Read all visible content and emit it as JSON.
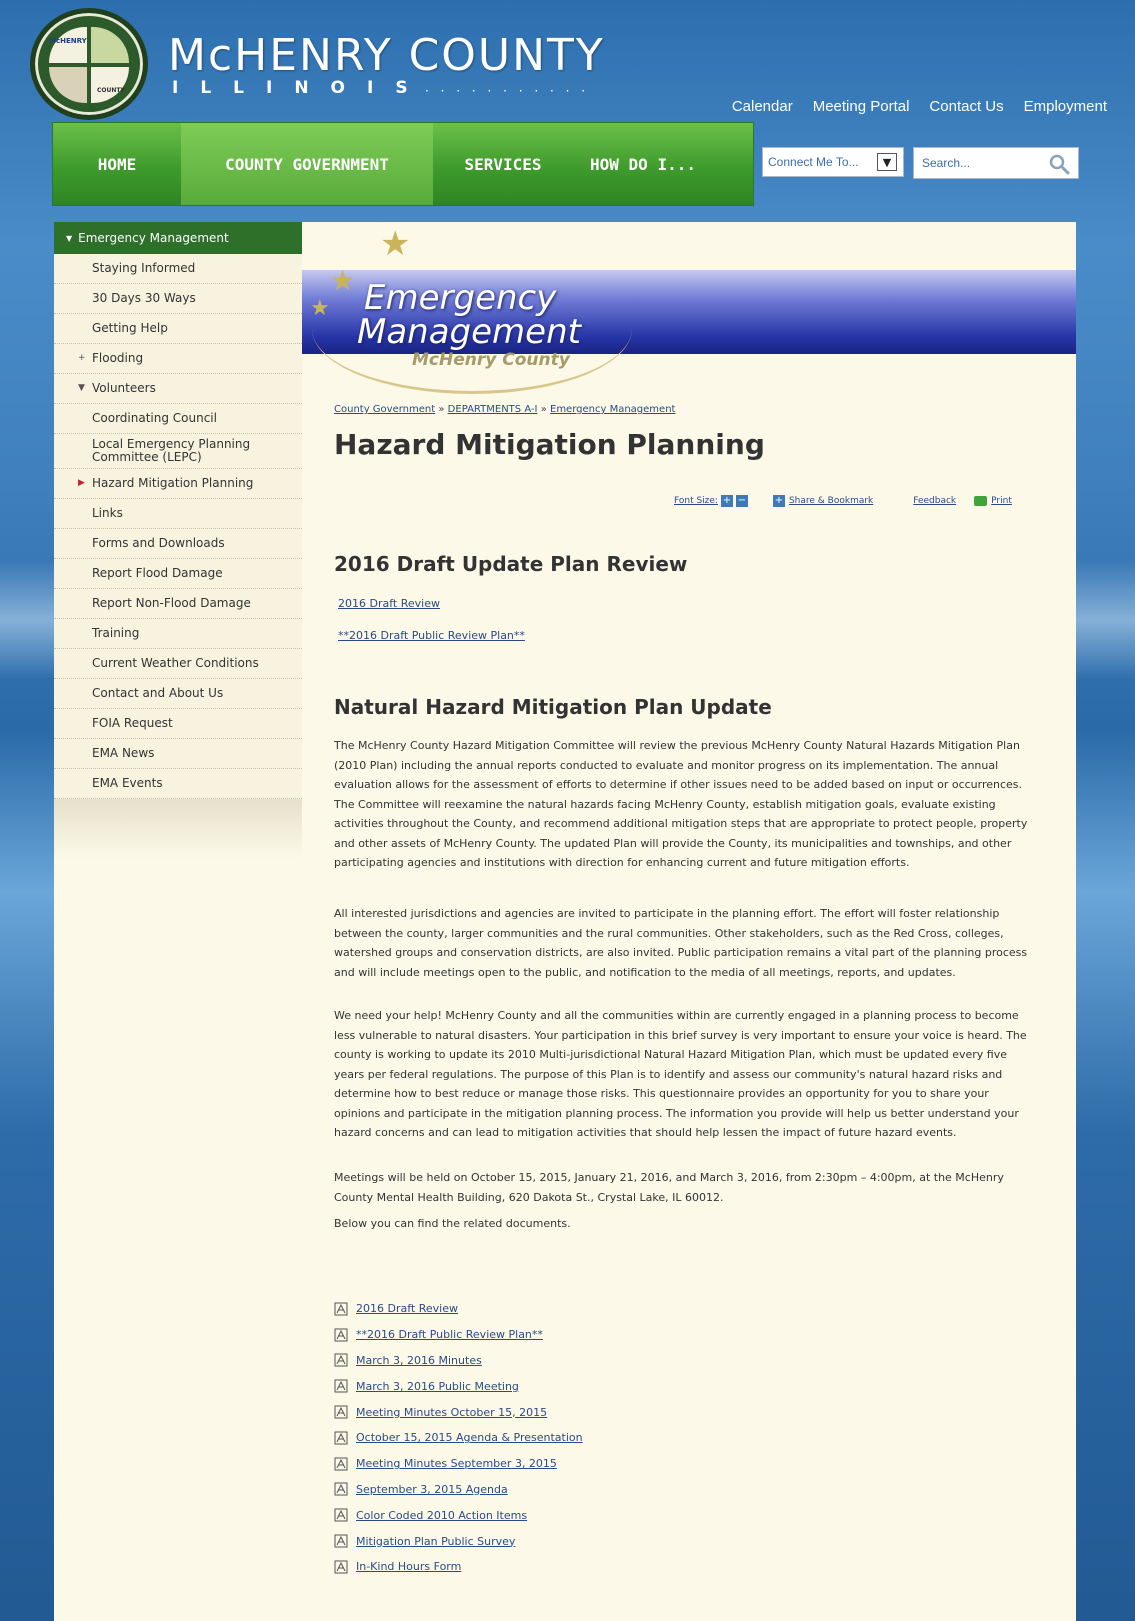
{
  "header": {
    "seal_text_top": "McHENRY",
    "seal_text_bottom": "COUNTY",
    "title": "McHENRY COUNTY",
    "subtitle": "ILLINOIS",
    "toplinks": [
      "Calendar",
      "Meeting Portal",
      "Contact Us",
      "Employment"
    ]
  },
  "nav": {
    "items": [
      "HOME",
      "COUNTY GOVERNMENT",
      "SERVICES",
      "HOW DO I..."
    ],
    "active_index": 1,
    "connect_label": "Connect Me To...",
    "search_placeholder": "Search..."
  },
  "sidebar": {
    "heading": "Emergency Management",
    "items": [
      {
        "label": "Staying Informed",
        "marker": ""
      },
      {
        "label": "30 Days 30 Ways",
        "marker": ""
      },
      {
        "label": "Getting Help",
        "marker": ""
      },
      {
        "label": "Flooding",
        "marker": "+"
      },
      {
        "label": "Volunteers",
        "marker": "▼"
      },
      {
        "label": "Coordinating Council",
        "marker": ""
      },
      {
        "label": "Local Emergency Planning Committee (LEPC)",
        "marker": ""
      },
      {
        "label": "Hazard Mitigation Planning",
        "marker": "▶"
      },
      {
        "label": "Links",
        "marker": ""
      },
      {
        "label": "Forms and Downloads",
        "marker": ""
      },
      {
        "label": "Report Flood Damage",
        "marker": ""
      },
      {
        "label": "Report Non-Flood Damage",
        "marker": ""
      },
      {
        "label": "Training",
        "marker": ""
      },
      {
        "label": "Current Weather Conditions",
        "marker": ""
      },
      {
        "label": "Contact and About Us",
        "marker": ""
      },
      {
        "label": "FOIA Request",
        "marker": ""
      },
      {
        "label": "EMA News",
        "marker": ""
      },
      {
        "label": "EMA Events",
        "marker": ""
      }
    ]
  },
  "banner": {
    "line1": "Emergency",
    "line2": "Management",
    "line3": "McHenry County"
  },
  "breadcrumb": {
    "items": [
      "County Government",
      "DEPARTMENTS A-I",
      "Emergency Management"
    ],
    "sep": "»"
  },
  "page_title": "Hazard Mitigation Planning",
  "tools": {
    "font_size": "Font Size:",
    "share": "Share & Bookmark",
    "feedback": "Feedback",
    "print": "Print"
  },
  "section1": {
    "heading": "2016 Draft Update Plan Review",
    "links": [
      "2016 Draft Review",
      "**2016 Draft Public Review Plan**"
    ]
  },
  "section2": {
    "heading": "Natural Hazard Mitigation Plan Update",
    "paragraphs": [
      "The McHenry County Hazard Mitigation Committee will review the previous McHenry County Natural Hazards Mitigation Plan (2010 Plan) including the annual reports conducted to evaluate and monitor progress on its implementation. The annual evaluation allows for the assessment of efforts to determine if other issues need to be added based on input or occurrences. The Committee will reexamine the natural hazards facing McHenry County, establish mitigation goals, evaluate existing activities throughout the County, and recommend additional mitigation steps that are appropriate to protect people, property and other assets of McHenry County. The updated Plan will provide the County, its municipalities and townships, and other participating agencies and institutions with direction for enhancing current and future mitigation efforts.",
      "All interested jurisdictions and agencies are invited to participate in the planning effort. The effort will foster relationship between the county, larger communities and the rural communities. Other stakeholders, such as the Red Cross, colleges, watershed groups and conservation districts, are also invited. Public participation remains a vital part of the planning process and will include meetings open to the public, and notification to the media of all meetings, reports, and updates.",
      "We need your help! McHenry County and all the communities within are currently engaged in a planning process to become less vulnerable to natural disasters. Your participation in this brief survey is very important to ensure your voice is heard. The county is working to update its 2010 Multi-jurisdictional Natural Hazard Mitigation Plan, which must be updated every five years per federal regulations.  The purpose of this Plan is to identify and assess our community's natural hazard risks and determine how to best reduce or manage those risks.  This questionnaire provides an opportunity for you to share your opinions and participate in the mitigation planning process.  The information you provide will help us better understand your hazard concerns and can lead to mitigation activities that should help lessen the impact of future hazard events.",
      "Meetings will be held on October 15, 2015, January 21, 2016, and March 3, 2016, from 2:30pm – 4:00pm, at the McHenry County Mental Health Building, 620 Dakota St., Crystal Lake, IL 60012.",
      "Below you can find the related documents."
    ]
  },
  "documents": [
    "2016 Draft Review",
    "**2016 Draft Public Review Plan**",
    "March 3, 2016 Minutes",
    "March 3, 2016 Public Meeting",
    "Meeting Minutes October 15, 2015",
    "October 15, 2015 Agenda & Presentation",
    "Meeting Minutes September 3, 2015",
    "September 3, 2015 Agenda",
    "Color Coded 2010 Action Items",
    "Mitigation Plan Public Survey",
    "In-Kind Hours Form"
  ],
  "colors": {
    "nav_green": "#3e9b2c",
    "sidebar_head": "#2e6f2a",
    "link_blue": "#2a4a88",
    "panel_bg": "#fcf9e9"
  }
}
